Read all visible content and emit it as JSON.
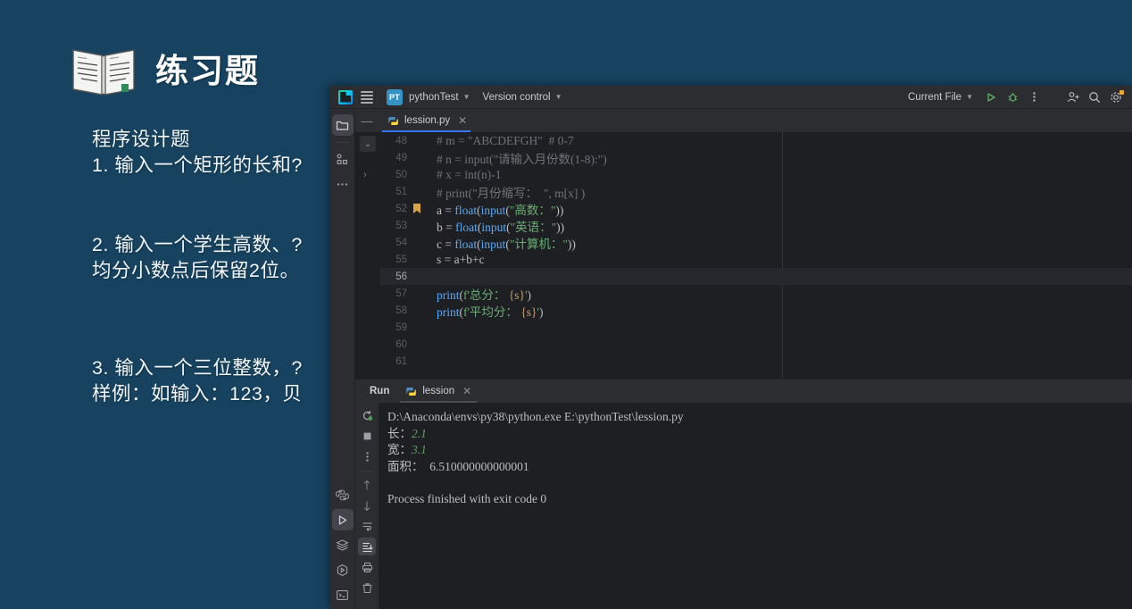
{
  "slide": {
    "title": "练习题",
    "book_icon": "open-book-icon",
    "heading": "程序设计题",
    "lines": [
      "1. 输入一个矩形的长和?",
      "2. 输入一个学生高数、?",
      "均分小数点后保留2位。",
      "3. 输入一个三位整数，?",
      "样例：如输入：123，贝"
    ],
    "bg_color": "#174360"
  },
  "ide": {
    "titlebar": {
      "app_icon": "pycharm-logo-icon",
      "menu_icon": "hamburger-menu-icon",
      "project_badge": "PT",
      "project_name": "pythonTest",
      "version_control": "Version control",
      "run_config": "Current File",
      "run_icon": "run-play-icon",
      "debug_icon": "debug-bug-icon",
      "more_icon": "more-vertical-icon",
      "account_icon": "account-add-icon",
      "search_icon": "search-icon",
      "settings_icon": "settings-gear-icon",
      "settings_badge_color": "#f0a732"
    },
    "left_toolwindows": [
      {
        "name": "project-folder-icon",
        "label": "Project",
        "selected": true
      },
      {
        "name": "commit-structure-icon",
        "label": "Commit",
        "selected": false
      },
      {
        "name": "more-tool-windows-icon",
        "label": "More",
        "selected": false
      }
    ],
    "bottom_toolwindows": [
      {
        "name": "python-packages-icon",
        "label": "Python Packages",
        "selected": false
      },
      {
        "name": "run-tool-icon",
        "label": "Run",
        "selected": true
      },
      {
        "name": "database-layers-icon",
        "label": "Database",
        "selected": false
      },
      {
        "name": "python-console-icon",
        "label": "Python Console",
        "selected": false
      },
      {
        "name": "terminal-icon",
        "label": "Terminal",
        "selected": false
      }
    ],
    "editor": {
      "tab_name": "lession.py",
      "tab_icon": "python-file-icon",
      "close_icon": "close-icon",
      "collapse_icon": "collapse-icon",
      "current_line": 56,
      "bookmark_line": 52,
      "lines": [
        {
          "n": 48,
          "tokens": [
            {
              "t": "# m = \"ABCDEFGH\"  # 0-7",
              "c": "c-comment"
            }
          ]
        },
        {
          "n": 49,
          "tokens": [
            {
              "t": "# n = input(\"请输入月份数(1-8):\")",
              "c": "c-comment"
            }
          ]
        },
        {
          "n": 50,
          "tokens": [
            {
              "t": "# x = int(n)-1",
              "c": "c-comment"
            }
          ]
        },
        {
          "n": 51,
          "tokens": [
            {
              "t": "# print(\"月份缩写：  \", m[x] )",
              "c": "c-comment"
            }
          ]
        },
        {
          "n": 52,
          "tokens": [
            {
              "t": "a = ",
              "c": "c-plain"
            },
            {
              "t": "float",
              "c": "c-func"
            },
            {
              "t": "(",
              "c": "c-plain"
            },
            {
              "t": "input",
              "c": "c-func"
            },
            {
              "t": "(",
              "c": "c-plain"
            },
            {
              "t": "\"高数：\"",
              "c": "c-str"
            },
            {
              "t": "))",
              "c": "c-plain"
            }
          ]
        },
        {
          "n": 53,
          "tokens": [
            {
              "t": "b = ",
              "c": "c-plain"
            },
            {
              "t": "float",
              "c": "c-func"
            },
            {
              "t": "(",
              "c": "c-plain"
            },
            {
              "t": "input",
              "c": "c-func"
            },
            {
              "t": "(",
              "c": "c-plain"
            },
            {
              "t": "\"英语：\"",
              "c": "c-str"
            },
            {
              "t": "))",
              "c": "c-plain"
            }
          ]
        },
        {
          "n": 54,
          "tokens": [
            {
              "t": "c = ",
              "c": "c-plain"
            },
            {
              "t": "float",
              "c": "c-func"
            },
            {
              "t": "(",
              "c": "c-plain"
            },
            {
              "t": "input",
              "c": "c-func"
            },
            {
              "t": "(",
              "c": "c-plain"
            },
            {
              "t": "\"计算机：\"",
              "c": "c-str"
            },
            {
              "t": "))",
              "c": "c-plain"
            }
          ]
        },
        {
          "n": 55,
          "tokens": [
            {
              "t": "s = a+b+c",
              "c": "c-plain"
            }
          ]
        },
        {
          "n": 56,
          "tokens": []
        },
        {
          "n": 57,
          "tokens": [
            {
              "t": "print",
              "c": "c-func"
            },
            {
              "t": "(",
              "c": "c-plain"
            },
            {
              "t": "f'总分：",
              "c": "c-fstr"
            },
            {
              "t": " {s}",
              "c": "c-brace"
            },
            {
              "t": "'",
              "c": "c-fstr"
            },
            {
              "t": ")",
              "c": "c-plain"
            }
          ]
        },
        {
          "n": 58,
          "tokens": [
            {
              "t": "print",
              "c": "c-func"
            },
            {
              "t": "(",
              "c": "c-plain"
            },
            {
              "t": "f'平均分：",
              "c": "c-fstr"
            },
            {
              "t": " {s}",
              "c": "c-brace"
            },
            {
              "t": "'",
              "c": "c-fstr"
            },
            {
              "t": ")",
              "c": "c-plain"
            }
          ]
        },
        {
          "n": 59,
          "tokens": []
        },
        {
          "n": 60,
          "tokens": []
        },
        {
          "n": 61,
          "tokens": []
        }
      ]
    },
    "run_panel": {
      "title": "Run",
      "tab_name": "lession",
      "tab_icon": "python-file-icon",
      "close_icon": "close-icon",
      "gutter": [
        {
          "name": "rerun-icon",
          "selected": false
        },
        {
          "name": "stop-icon",
          "selected": false
        },
        {
          "name": "more-vertical-icon",
          "selected": false
        },
        {
          "name": "up-arrow-icon",
          "selected": false
        },
        {
          "name": "down-arrow-icon",
          "selected": false
        },
        {
          "name": "soft-wrap-icon",
          "selected": false
        },
        {
          "name": "scroll-to-end-icon",
          "selected": true
        },
        {
          "name": "print-icon",
          "selected": false
        },
        {
          "name": "trash-icon",
          "selected": false
        }
      ],
      "console": [
        {
          "text": "D:\\Anaconda\\envs\\py38\\python.exe E:\\pythonTest\\lession.py",
          "parts": null
        },
        {
          "parts": [
            {
              "t": "长：",
              "c": ""
            },
            {
              "t": "2.1",
              "c": "con-in"
            }
          ]
        },
        {
          "parts": [
            {
              "t": "宽：",
              "c": ""
            },
            {
              "t": "3.1",
              "c": "con-in"
            }
          ]
        },
        {
          "text": "面积：  6.510000000000001",
          "parts": null
        },
        {
          "text": "",
          "parts": null
        },
        {
          "text": "Process finished with exit code 0",
          "parts": null
        }
      ]
    }
  }
}
